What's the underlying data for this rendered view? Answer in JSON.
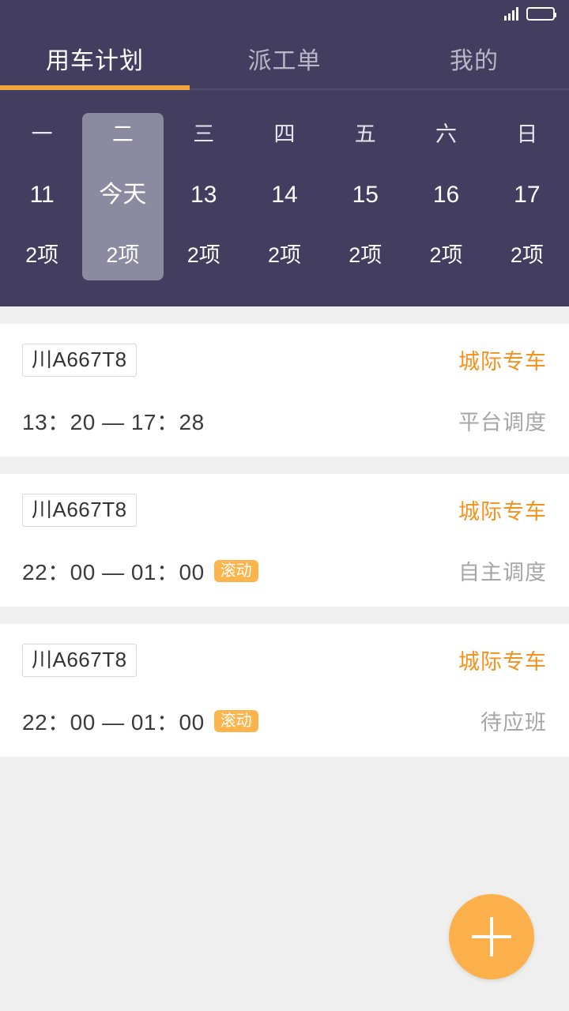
{
  "statusbar": {
    "signal_icon": "signal-bars-icon",
    "battery_icon": "battery-icon"
  },
  "tabs": [
    {
      "label": "用车计划",
      "active": true
    },
    {
      "label": "派工单",
      "active": false
    },
    {
      "label": "我的",
      "active": false
    }
  ],
  "colors": {
    "header_bg": "#433e60",
    "accent_orange": "#f0a63c",
    "category_orange": "#f5921e",
    "badge_orange": "#fbb54c",
    "today_cell": "#8c8aa0",
    "page_bg": "#efefef",
    "dispatch_gray": "#a6a6a6"
  },
  "datestrip": [
    {
      "dow": "一",
      "date": "11",
      "count": "2项",
      "today": false
    },
    {
      "dow": "二",
      "date": "今天",
      "count": "2项",
      "today": true
    },
    {
      "dow": "三",
      "date": "13",
      "count": "2项",
      "today": false
    },
    {
      "dow": "四",
      "date": "14",
      "count": "2项",
      "today": false
    },
    {
      "dow": "五",
      "date": "15",
      "count": "2项",
      "today": false
    },
    {
      "dow": "六",
      "date": "16",
      "count": "2项",
      "today": false
    },
    {
      "dow": "日",
      "date": "17",
      "count": "2项",
      "today": false
    }
  ],
  "plans": [
    {
      "plate": "川A667T8",
      "category": "城际专车",
      "time": "13：20 — 17：28",
      "badge": "",
      "dispatch": "平台调度"
    },
    {
      "plate": "川A667T8",
      "category": "城际专车",
      "time": "22：00 — 01：00",
      "badge": "滚动",
      "dispatch": "自主调度"
    },
    {
      "plate": "川A667T8",
      "category": "城际专车",
      "time": "22：00 — 01：00",
      "badge": "滚动",
      "dispatch": "待应班"
    }
  ],
  "fab": {
    "icon": "plus-icon",
    "label": "+"
  }
}
